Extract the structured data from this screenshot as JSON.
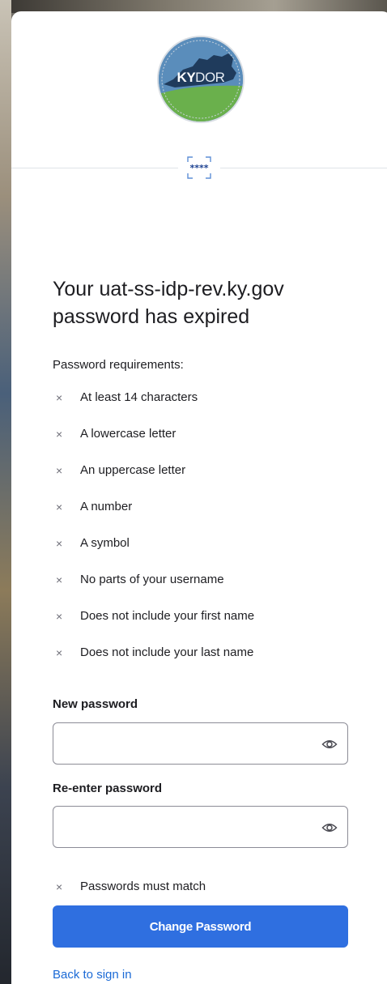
{
  "logo": {
    "ky": "KY",
    "dor": "DOR"
  },
  "title": "Your uat-ss-idp-rev.ky.gov password has expired",
  "requirements": {
    "heading": "Password requirements:",
    "items": [
      "At least 14 characters",
      "A lowercase letter",
      "An uppercase letter",
      "A number",
      "A symbol",
      "No parts of your username",
      "Does not include your first name",
      "Does not include your last name"
    ],
    "mark": "×"
  },
  "new_password": {
    "label": "New password",
    "value": ""
  },
  "reenter_password": {
    "label": "Re-enter password",
    "value": ""
  },
  "match_rule": "Passwords must match",
  "submit_label": "Change Password",
  "back_link": "Back to sign in",
  "colors": {
    "accent": "#2f6fe0",
    "link": "#1b6ad6",
    "logo_blue": "#4e7fae",
    "logo_green": "#6ab04c",
    "logo_dark": "#1f3b5c"
  }
}
